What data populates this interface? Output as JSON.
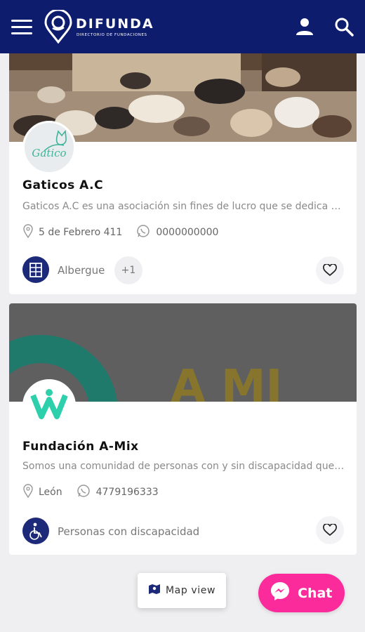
{
  "header": {
    "brand_name": "DIFUNDA",
    "brand_tagline": "DIRECTORIO DE FUNDACIONES",
    "menu_icon": "hamburger-menu-icon",
    "user_icon": "user-icon",
    "search_icon": "search-icon",
    "background": "#0e1c6e"
  },
  "cards": [
    {
      "avatar_text": "Gatico",
      "title": "Gaticos A.C",
      "description": "Gaticos A.C es una asociación sin fines de lucro que se dedica al rescate, rehabilitación y adopción de gatos",
      "address": "5 de Febrero 411",
      "phone": "0000000000",
      "category": "Albergue",
      "more_count": "+1",
      "category_icon": "shelter-icon",
      "favorite_icon": "heart-icon"
    },
    {
      "banner_text": "A  MI",
      "title": "Fundación A-Mix",
      "description": "Somos una comunidad de personas con y sin discapacidad que trabajan juntas por la inclusión",
      "address": "León",
      "phone": "4779196333",
      "category": "Personas con discapacidad",
      "category_icon": "wheelchair-icon",
      "favorite_icon": "heart-icon"
    }
  ],
  "map_view_label": "Map view",
  "chat_label": "Chat",
  "colors": {
    "accent": "#fb2b9b",
    "navy": "#1d2a7a",
    "teal": "#2ed0ab"
  }
}
